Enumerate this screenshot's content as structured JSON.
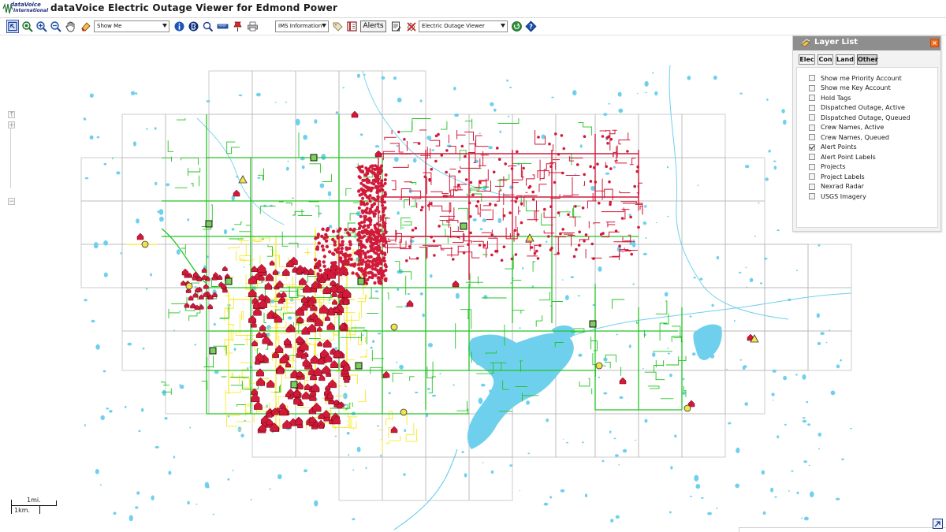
{
  "header": {
    "logo_line1": "dataVoice",
    "logo_line2": "International",
    "title": "dataVoice Electric Outage Viewer for Edmond Power"
  },
  "toolbar": {
    "tools": [
      {
        "name": "identify-area-icon"
      },
      {
        "name": "zoom-full-icon"
      },
      {
        "name": "zoom-in-icon"
      },
      {
        "name": "zoom-out-icon"
      },
      {
        "name": "pan-hand-icon"
      },
      {
        "name": "eraser-icon"
      }
    ],
    "show_me_select": "Show Me",
    "info_tools": [
      {
        "name": "info-icon"
      },
      {
        "name": "hyperlink-icon"
      },
      {
        "name": "search-icon"
      },
      {
        "name": "measure-icon"
      },
      {
        "name": "pushpin-icon"
      },
      {
        "name": "print-icon"
      }
    ],
    "ims_select": "IMS Information",
    "tag_tool": "tag-icon",
    "legend_tool": "legend-book-icon",
    "alerts_label": "Alerts",
    "notes_tool": "notes-icon",
    "clear_tool": "clear-selection-icon",
    "viewer_select": "Electric Outage Viewer",
    "go_tool": "go-icon",
    "help_tool": "help-icon"
  },
  "map": {
    "zoom_in_label": "+",
    "zoom_out_label": "−",
    "zoom_top_label": "↑",
    "scale_mi": "1mi.",
    "scale_km": "1km.",
    "colors": {
      "feeder_green": "#22c322",
      "feeder_yellow": "#f5ea2a",
      "outage_red": "#d11a3a",
      "water": "#6fd0ee",
      "grid": "#b7b7b7"
    }
  },
  "layer_panel": {
    "title": "Layer List",
    "close_label": "×",
    "tabs": [
      {
        "label": "Elec",
        "active": false
      },
      {
        "label": "Con",
        "active": false
      },
      {
        "label": "Land",
        "active": false
      },
      {
        "label": "Other",
        "active": true
      }
    ],
    "layers": [
      {
        "label": "Show me Priority Account",
        "checked": false
      },
      {
        "label": "Show me Key Account",
        "checked": false
      },
      {
        "label": "Hold Tags",
        "checked": false
      },
      {
        "label": "Dispatched Outage, Active",
        "checked": false
      },
      {
        "label": "Dispatched Outage, Queued",
        "checked": false
      },
      {
        "label": "Crew Names, Active",
        "checked": false
      },
      {
        "label": "Crew Names, Queued",
        "checked": false
      },
      {
        "label": "Alert Points",
        "checked": true
      },
      {
        "label": "Alert Point Labels",
        "checked": false
      },
      {
        "label": "Projects",
        "checked": false
      },
      {
        "label": "Project Labels",
        "checked": false
      },
      {
        "label": "Nexrad Radar",
        "checked": false
      },
      {
        "label": "USGS Imagery",
        "checked": false
      }
    ]
  }
}
